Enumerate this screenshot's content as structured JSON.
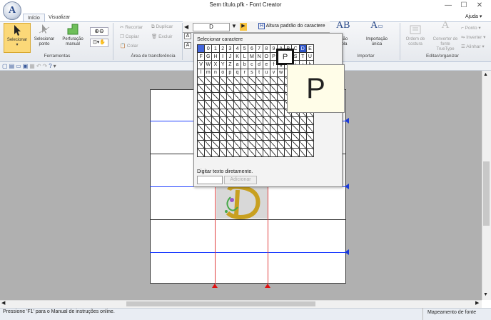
{
  "window": {
    "title": "Sem título.pfk - Font Creator",
    "help": "Ajuda",
    "minimize": "—",
    "maximize": "☐",
    "close": "✕"
  },
  "app_button": "A",
  "tabs": [
    {
      "label": "Início",
      "active": true
    },
    {
      "label": "Visualizar",
      "active": false
    }
  ],
  "ribbon": {
    "tools": {
      "select": "Selecionar",
      "select_point": "Selecionar ponto",
      "perforation": "Perfuração manual",
      "label": "Ferramentas"
    },
    "clipboard": {
      "cut": "Recortar",
      "duplicate": "Duplicar",
      "copy": "Copiar",
      "delete": "Excluir",
      "paste": "Colar",
      "label": "Área de transferência"
    },
    "char_selector": {
      "value": "D",
      "height_button": "Altura padrão do caractere"
    },
    "import": {
      "import_multi_partial": "lação",
      "import_multi_partial2": "mpla",
      "import_single": "Importação",
      "import_single2": "única",
      "label": "Importar"
    },
    "edit": {
      "sew_order": "Ordem de",
      "sew_order2": "costura",
      "convert": "Converter de",
      "convert2": "fonte TrueType",
      "point": "Ponto",
      "invert": "Inverter",
      "align": "Alinhar",
      "label": "Editar/organizar"
    }
  },
  "dialog": {
    "select_char_label": "Selecionar caractere",
    "rows": [
      [
        "",
        "0",
        "1",
        "2",
        "3",
        "4",
        "5",
        "6",
        "7",
        "8",
        "9",
        "A",
        "B",
        "C",
        "D",
        "E"
      ],
      [
        "F",
        "G",
        "H",
        "I",
        "J",
        "K",
        "L",
        "M",
        "N",
        "O",
        "P",
        "Q",
        "R",
        "S",
        "T",
        "U"
      ],
      [
        "V",
        "W",
        "X",
        "Y",
        "Z",
        "a",
        "b",
        "c",
        "d",
        "e",
        "f",
        "g",
        "h",
        "i",
        "j",
        "k"
      ],
      [
        "l",
        "m",
        "n",
        "o",
        "p",
        "q",
        "r",
        "s",
        "t",
        "u",
        "v",
        "w",
        "x",
        "y",
        "z",
        ""
      ]
    ],
    "empty_rows": 10,
    "highlighted_char": "P",
    "preview_char": "P",
    "type_text_label": "Digitar texto diretamente.",
    "add_button": "Adicionar"
  },
  "status": {
    "left": "Pressione 'F1' para o Manual de instruções online.",
    "right": "Mapeamento de fonte"
  },
  "colors": {
    "guide_blue": "#2040ff",
    "guide_red": "#e04040",
    "glyph_gold": "#c8a020",
    "glyph_green": "#48a848",
    "selected_cell": "#4466dd"
  }
}
